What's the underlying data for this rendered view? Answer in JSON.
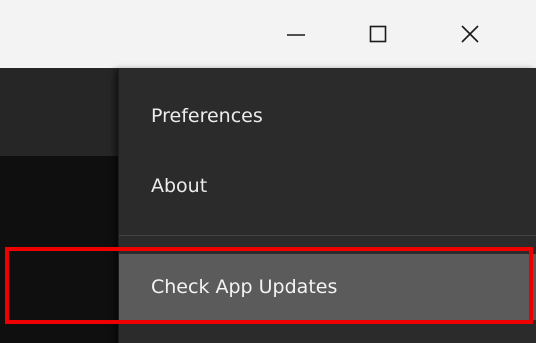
{
  "window_controls": {
    "minimize_icon": "minimize-icon",
    "maximize_icon": "maximize-icon",
    "close_icon": "close-icon"
  },
  "menu": {
    "items": [
      {
        "label": "Preferences"
      },
      {
        "label": "About"
      },
      {
        "label": "Check App Updates"
      }
    ],
    "highlight_color": "#5b5b5b"
  },
  "annotation": {
    "color": "#ee0000"
  }
}
